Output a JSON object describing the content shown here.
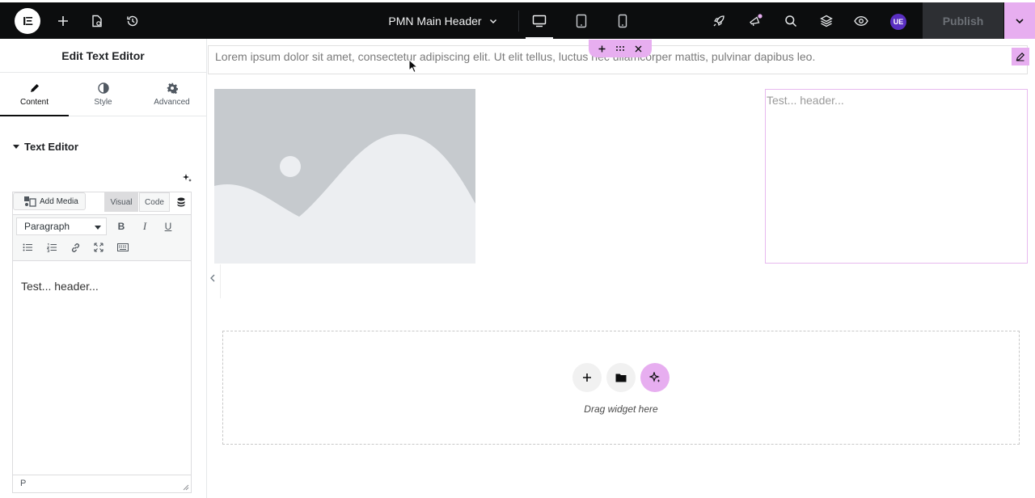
{
  "topbar": {
    "document_title": "PMN Main Header",
    "publish_label": "Publish",
    "user_initials": "UE"
  },
  "panel": {
    "title": "Edit Text Editor",
    "tabs": [
      {
        "label": "Content",
        "icon": "pencil-icon",
        "active": true
      },
      {
        "label": "Style",
        "icon": "contrast-icon",
        "active": false
      },
      {
        "label": "Advanced",
        "icon": "gear-icon",
        "active": false
      }
    ],
    "section_title": "Text Editor",
    "editor": {
      "add_media_label": "Add Media",
      "mode_visual": "Visual",
      "mode_code": "Code",
      "format_value": "Paragraph",
      "bold": "B",
      "italic": "I",
      "underline": "U",
      "content": "Test... header...",
      "status_path": "P"
    }
  },
  "canvas": {
    "lorem_text": "Lorem ipsum dolor sit amet, consectetur adipiscing elit. Ut elit tellus, luctus nec ullamcorper mattis, pulvinar dapibus leo.",
    "text_box_content": "Test... header...",
    "dropzone_label": "Drag widget here"
  },
  "colors": {
    "accent_pink": "#e7aef0",
    "topbar_bg": "#0c0d0e",
    "avatar_bg": "#5a2fc2"
  }
}
